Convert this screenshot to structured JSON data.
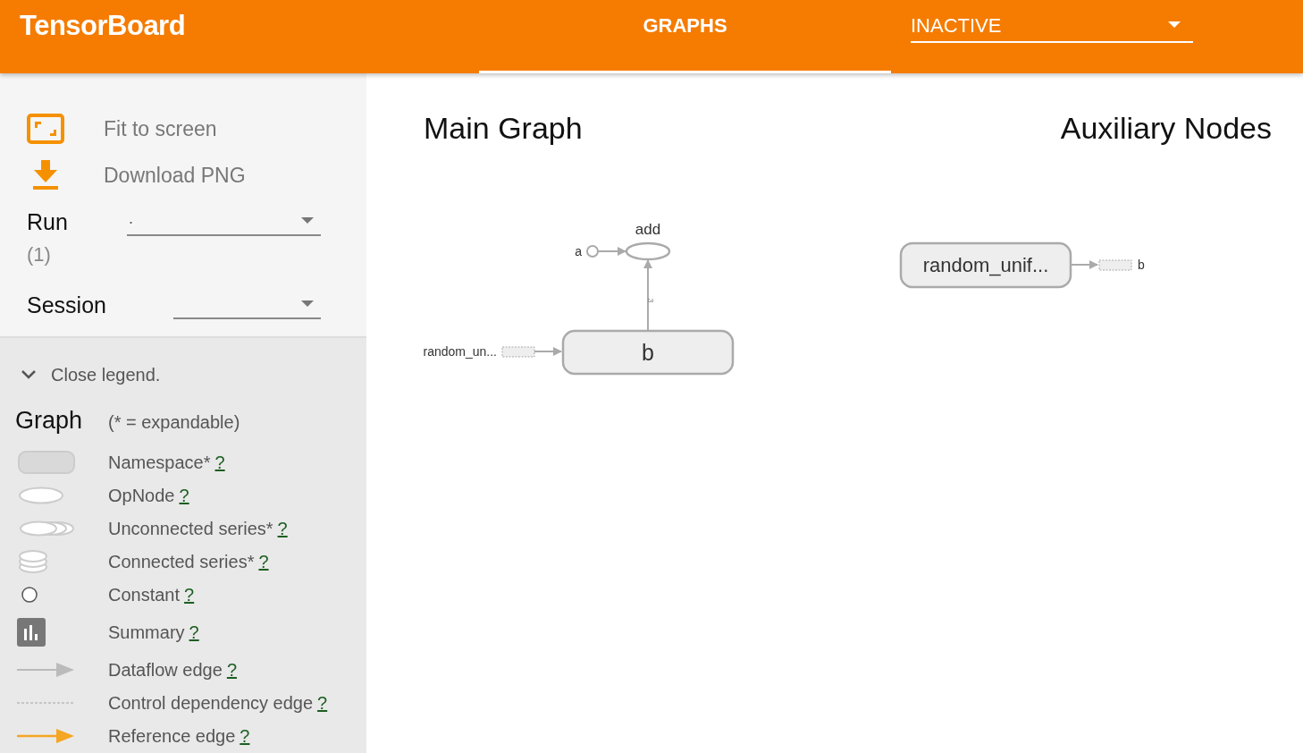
{
  "header": {
    "title": "TensorBoard",
    "tabs": [
      {
        "label": "GRAPHS",
        "selected": true
      }
    ],
    "mode_select": {
      "value": "INACTIVE"
    }
  },
  "sidebar": {
    "actions": [
      {
        "kind": "fit",
        "label": "Fit to screen"
      },
      {
        "kind": "download",
        "label": "Download PNG"
      }
    ],
    "run": {
      "label": "Run",
      "count": "(1)",
      "value": "."
    },
    "session": {
      "label": "Session"
    },
    "legend": {
      "toggle": "Close legend.",
      "expanded": true,
      "title": "Graph",
      "note": "(* = expandable)",
      "items": [
        {
          "kind": "namespace",
          "label": "Namespace*",
          "help": "?"
        },
        {
          "kind": "opnode",
          "label": "OpNode",
          "help": "?"
        },
        {
          "kind": "unconnected",
          "label": "Unconnected series*",
          "help": "?"
        },
        {
          "kind": "connected",
          "label": "Connected series*",
          "help": "?"
        },
        {
          "kind": "constant",
          "label": "Constant",
          "help": "?"
        },
        {
          "kind": "summary",
          "label": "Summary",
          "help": "?"
        },
        {
          "kind": "dataflow",
          "label": "Dataflow edge",
          "help": "?"
        },
        {
          "kind": "control",
          "label": "Control dependency edge",
          "help": "?"
        },
        {
          "kind": "reference",
          "label": "Reference edge",
          "help": "?"
        }
      ]
    }
  },
  "main_graph": {
    "title": "Main Graph",
    "nodes": [
      {
        "kind": "opnode",
        "label": "add"
      },
      {
        "kind": "constant",
        "label": "a"
      },
      {
        "kind": "namespace",
        "label": "b"
      },
      {
        "kind": "stub",
        "label": "random_un..."
      }
    ],
    "edge_label": "3"
  },
  "auxiliary": {
    "title": "Auxiliary Nodes",
    "nodes": [
      {
        "kind": "namespace",
        "label": "random_unif..."
      },
      {
        "kind": "stub",
        "label": "b"
      }
    ]
  }
}
